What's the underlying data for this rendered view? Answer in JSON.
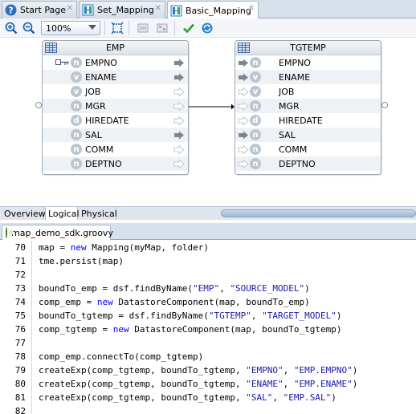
{
  "doc_tabs": [
    {
      "label": "Start Page",
      "icon": "help-icon"
    },
    {
      "label": "Set_Mapping",
      "icon": "mapping-icon"
    },
    {
      "label": "Basic_Mapping",
      "icon": "mapping-icon",
      "active": true
    }
  ],
  "toolbar": {
    "zoom": "100%"
  },
  "diagram": {
    "source": {
      "title": "EMP",
      "attributes": [
        {
          "name": "EMPNO",
          "type_letter": "n",
          "key": true,
          "mapped": true
        },
        {
          "name": "ENAME",
          "type_letter": "v",
          "mapped": true
        },
        {
          "name": "JOB",
          "type_letter": "v",
          "mapped": false
        },
        {
          "name": "MGR",
          "type_letter": "n",
          "mapped": false
        },
        {
          "name": "HIREDATE",
          "type_letter": "d",
          "mapped": false
        },
        {
          "name": "SAL",
          "type_letter": "n",
          "mapped": true
        },
        {
          "name": "COMM",
          "type_letter": "n",
          "mapped": false
        },
        {
          "name": "DEPTNO",
          "type_letter": "n",
          "mapped": false
        }
      ]
    },
    "target": {
      "title": "TGTEMP",
      "attributes": [
        {
          "name": "EMPNO",
          "type_letter": "n",
          "mapped": true
        },
        {
          "name": "ENAME",
          "type_letter": "v",
          "mapped": true
        },
        {
          "name": "JOB",
          "type_letter": "v",
          "mapped": false
        },
        {
          "name": "MGR",
          "type_letter": "n",
          "mapped": false
        },
        {
          "name": "HIREDATE",
          "type_letter": "d",
          "mapped": false
        },
        {
          "name": "SAL",
          "type_letter": "n",
          "mapped": true
        },
        {
          "name": "COMM",
          "type_letter": "n",
          "mapped": false
        },
        {
          "name": "DEPTNO",
          "type_letter": "n",
          "mapped": false
        }
      ]
    }
  },
  "view_tabs": [
    {
      "label": "Overview"
    },
    {
      "label": "Logical",
      "active": true
    },
    {
      "label": "Physical"
    }
  ],
  "editor": {
    "tab_label": "map_demo_sdk.groovy",
    "lines": [
      {
        "num": "70",
        "text": "map = new Mapping(myMap, folder)"
      },
      {
        "num": "71",
        "text": "tme.persist(map)"
      },
      {
        "num": "72",
        "text": ""
      },
      {
        "num": "73",
        "text": "boundTo_emp = dsf.findByName(\"EMP\", \"SOURCE_MODEL\")"
      },
      {
        "num": "74",
        "text": "comp_emp = new DatastoreComponent(map, boundTo_emp)"
      },
      {
        "num": "75",
        "text": "boundTo_tgtemp = dsf.findByName(\"TGTEMP\", \"TARGET_MODEL\")"
      },
      {
        "num": "76",
        "text": "comp_tgtemp = new DatastoreComponent(map, boundTo_tgtemp)"
      },
      {
        "num": "77",
        "text": ""
      },
      {
        "num": "78",
        "text": "comp_emp.connectTo(comp_tgtemp)"
      },
      {
        "num": "79",
        "text": "createExp(comp_tgtemp, boundTo_tgtemp, \"EMPNO\", \"EMP.EMPNO\")"
      },
      {
        "num": "80",
        "text": "createExp(comp_tgtemp, boundTo_tgtemp, \"ENAME\", \"EMP.ENAME\")"
      },
      {
        "num": "81",
        "text": "createExp(comp_tgtemp, boundTo_tgtemp, \"SAL\", \"EMP.SAL\")"
      },
      {
        "num": "82",
        "text": ""
      }
    ]
  },
  "colors": {
    "keyword": "#0000ff",
    "string": "#1a1aa6",
    "arrow_filled": "#7d858d",
    "arrow_hollow": "#c2c8ce",
    "tab_active_icon": "#2b8fd3"
  }
}
